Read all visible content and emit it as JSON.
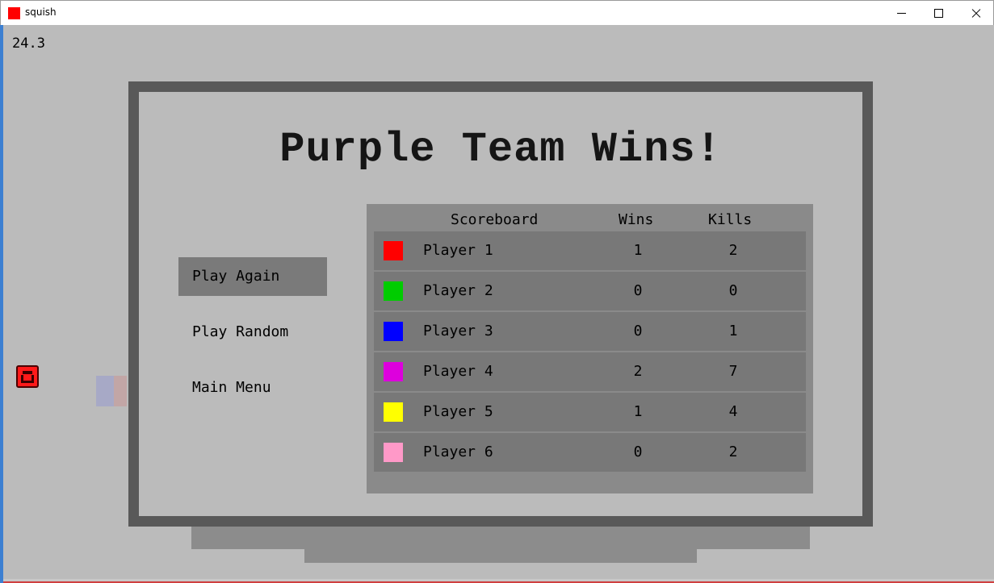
{
  "window": {
    "title": "squish",
    "icon": "red-square-icon",
    "controls": [
      "minimize-icon",
      "maximize-icon",
      "close-icon"
    ]
  },
  "hud": {
    "fps": "24.3"
  },
  "dialog": {
    "title": "Purple Team Wins!",
    "menu": [
      {
        "label": "Play Again",
        "selected": true
      },
      {
        "label": "Play Random",
        "selected": false
      },
      {
        "label": "Main Menu",
        "selected": false
      }
    ],
    "scoreboard": {
      "headers": {
        "title": "Scoreboard",
        "wins": "Wins",
        "kills": "Kills"
      },
      "players": [
        {
          "name": "Player 1",
          "color": "#ff0000",
          "wins": "1",
          "kills": "2"
        },
        {
          "name": "Player 2",
          "color": "#00cc00",
          "wins": "0",
          "kills": "0"
        },
        {
          "name": "Player 3",
          "color": "#0000ff",
          "wins": "0",
          "kills": "1"
        },
        {
          "name": "Player 4",
          "color": "#dd00dd",
          "wins": "2",
          "kills": "7"
        },
        {
          "name": "Player 5",
          "color": "#ffff00",
          "wins": "1",
          "kills": "4"
        },
        {
          "name": "Player 6",
          "color": "#ff99c8",
          "wins": "0",
          "kills": "2"
        }
      ]
    }
  }
}
